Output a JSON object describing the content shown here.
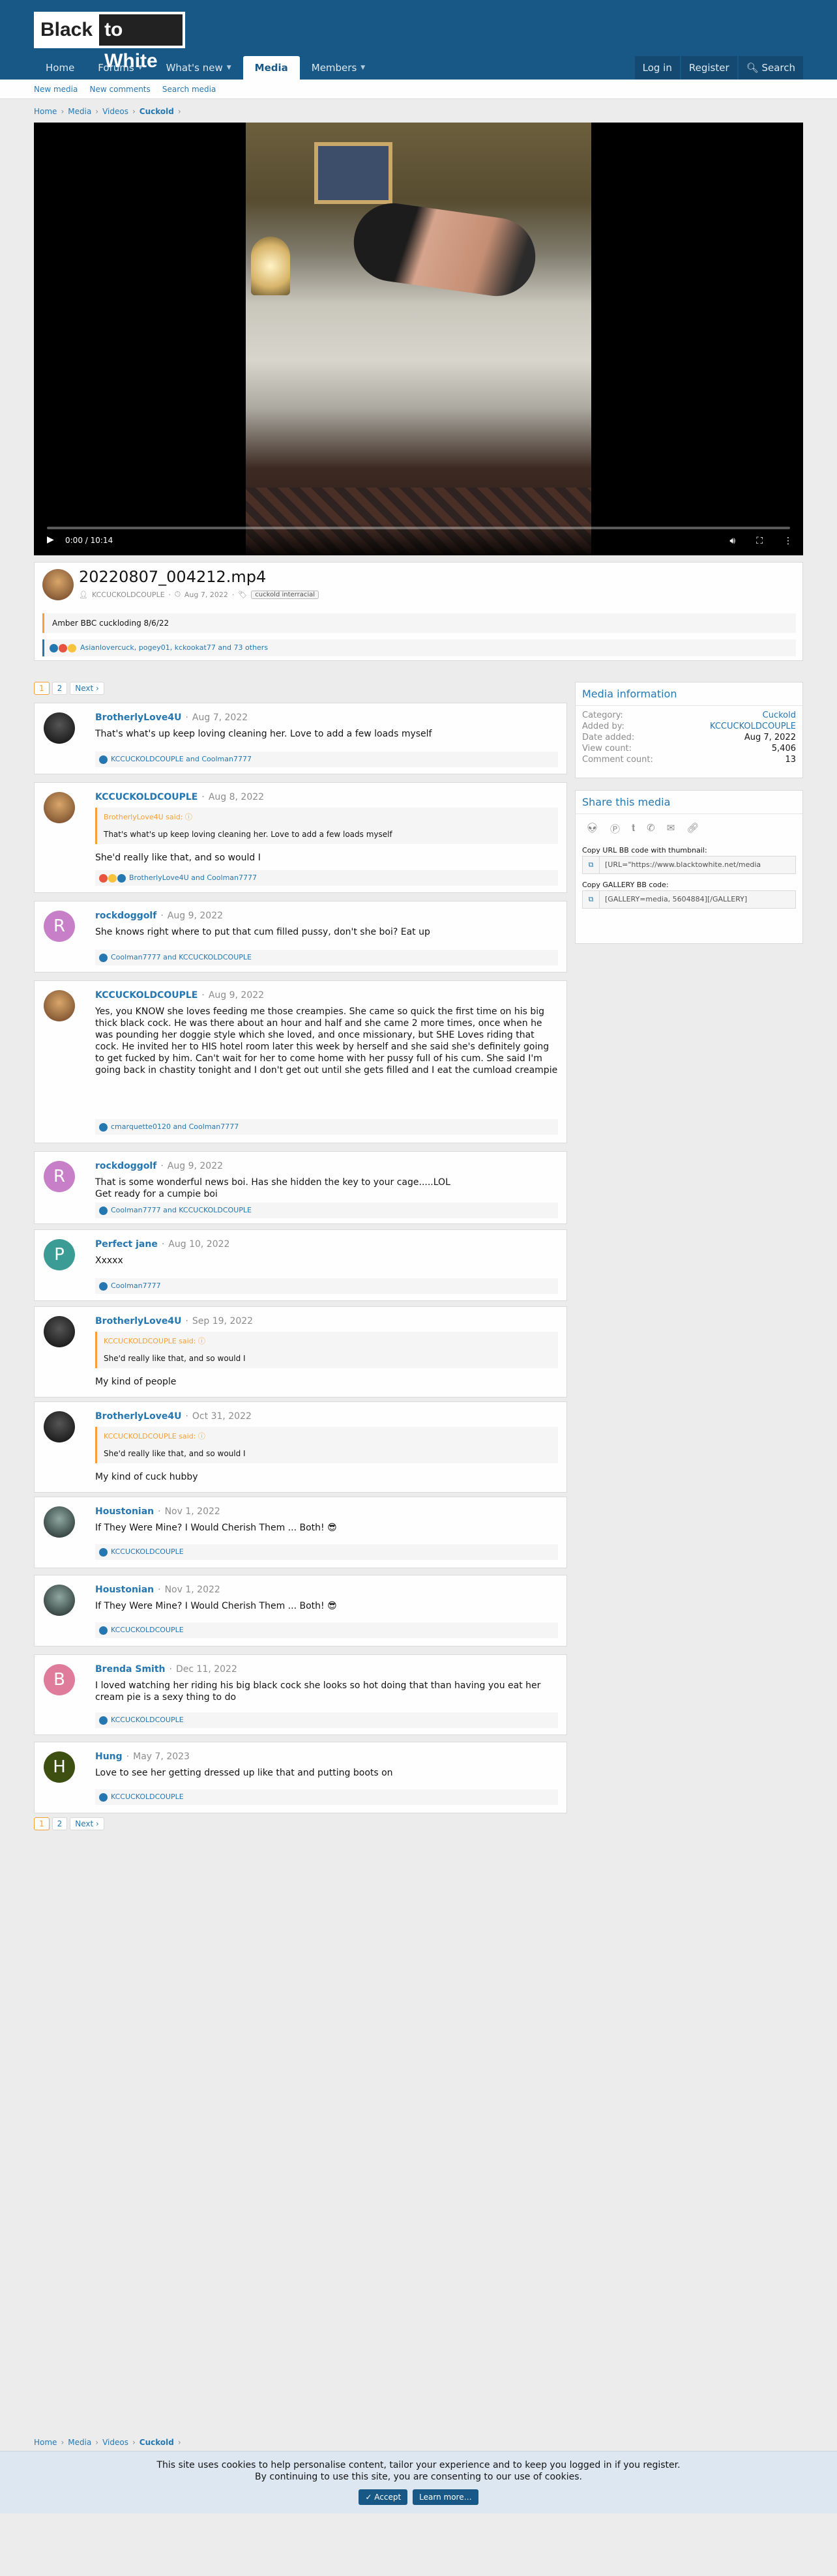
{
  "site": {
    "logo_word1": "Black",
    "logo_word2": "to White"
  },
  "nav": {
    "tabs": [
      {
        "label": "Home"
      },
      {
        "label": "Forums"
      },
      {
        "label": "What's new"
      },
      {
        "label": "Media"
      },
      {
        "label": "Members"
      }
    ],
    "login": "Log in",
    "register": "Register",
    "search": "Search"
  },
  "subnav": {
    "items": [
      "New media",
      "New comments",
      "Search media"
    ]
  },
  "breadcrumb": [
    "Home",
    "Media",
    "Videos",
    "Cuckold"
  ],
  "video": {
    "time": "0:00 / 10:14",
    "progress_fraction": 0
  },
  "media": {
    "title": "20220807_004212.mp4",
    "author": "KCCUCKOLDCOUPLE",
    "date": "Aug 7, 2022",
    "tag": "cuckold interracial",
    "description": "Amber BBC cuckloding 8/6/22",
    "reactions": "Asianlovercuck, pogey01, kckookat77 and 73 others"
  },
  "pagination": {
    "pages": [
      "1",
      "2"
    ],
    "next": "Next ›"
  },
  "comments": [
    {
      "user": "BrotherlyLove4U",
      "date": "Aug 7, 2022",
      "text": "That's what's up keep loving cleaning her. Love to add a few loads myself",
      "reactions": "KCCUCKOLDCOUPLE and Coolman7777"
    },
    {
      "user": "KCCUCKOLDCOUPLE",
      "date": "Aug 8, 2022",
      "quote_head": "BrotherlyLove4U said: ⓘ",
      "quote": "That's what's up keep loving cleaning her. Love to add a few loads myself",
      "text": "She'd really like that, and so would I",
      "reactions": "BrotherlyLove4U and Coolman7777"
    },
    {
      "user": "rockdoggolf",
      "date": "Aug 9, 2022",
      "avatar_letter": "R",
      "text": "She knows right where to put that cum filled pussy, don't she boi? Eat up",
      "reactions": "Coolman7777 and KCCUCKOLDCOUPLE"
    },
    {
      "user": "KCCUCKOLDCOUPLE",
      "date": "Aug 9, 2022",
      "text": "Yes, you KNOW she loves feeding me those creampies. She came so quick the first time on his big thick black cock. He was there about an hour and half and she came 2 more times, once when he was pounding her doggie style which she loved, and once missionary, but SHE Loves riding that cock. He invited her to HIS hotel room later this week by herself and she said she's definitely going to get fucked by him. Can't wait for her to come home with her pussy full of his cum. She said I'm going back in chastity tonight and I don't get out until she gets filled and I eat the cumload creampie",
      "reactions": "cmarquette0120 and Coolman7777"
    },
    {
      "user": "rockdoggolf",
      "date": "Aug 9, 2022",
      "avatar_letter": "R",
      "text": "That is some wonderful news boi. Has she hidden the key to your cage.....LOL",
      "text2": "Get ready for a cumpie boi",
      "reactions": "Coolman7777 and KCCUCKOLDCOUPLE"
    },
    {
      "user": "Perfect jane",
      "date": "Aug 10, 2022",
      "avatar_letter": "P",
      "text": "Xxxxx",
      "reactions": "Coolman7777"
    },
    {
      "user": "BrotherlyLove4U",
      "date": "Sep 19, 2022",
      "quote_head": "KCCUCKOLDCOUPLE said: ⓘ",
      "quote": "She'd really like that, and so would I",
      "text": "My kind of people"
    },
    {
      "user": "BrotherlyLove4U",
      "date": "Oct 31, 2022",
      "quote_head": "KCCUCKOLDCOUPLE said: ⓘ",
      "quote": "She'd really like that, and so would I",
      "text": "My kind of cuck hubby"
    },
    {
      "user": "Houstonian",
      "date": "Nov 1, 2022",
      "text": "If They Were Mine? I Would Cherish Them ... Both! 😎",
      "reactions": "KCCUCKOLDCOUPLE"
    },
    {
      "user": "Houstonian",
      "date": "Nov 1, 2022",
      "text": "If They Were Mine? I Would Cherish Them ... Both! 😎",
      "reactions": "KCCUCKOLDCOUPLE"
    },
    {
      "user": "Brenda Smith",
      "date": "Dec 11, 2022",
      "avatar_letter": "B",
      "text": "I loved watching her riding his big black cock she looks so hot doing that than having you eat her cream pie is a sexy thing to do",
      "reactions": "KCCUCKOLDCOUPLE"
    },
    {
      "user": "Hung",
      "date": "May 7, 2023",
      "avatar_letter": "H",
      "text": "Love to see her getting dressed up like that and putting boots on",
      "reactions": "KCCUCKOLDCOUPLE"
    }
  ],
  "media_info": {
    "heading": "Media information",
    "rows": [
      {
        "k": "Category:",
        "v": "Cuckold"
      },
      {
        "k": "Added by:",
        "v": "KCCUCKOLDCOUPLE"
      },
      {
        "k": "Date added:",
        "v": "Aug 7, 2022"
      },
      {
        "k": "View count:",
        "v": "5,406"
      },
      {
        "k": "Comment count:",
        "v": "13"
      }
    ]
  },
  "share": {
    "heading": "Share this media",
    "icons": [
      "reddit-icon",
      "pinterest-icon",
      "tumblr-icon",
      "whatsapp-icon",
      "email-icon",
      "link-icon"
    ],
    "url_label": "Copy URL BB code with thumbnail:",
    "url_value": "[URL=\"https://www.blacktowhite.net/media",
    "gallery_label": "Copy GALLERY BB code:",
    "gallery_value": "[GALLERY=media, 5604884][/GALLERY]"
  },
  "cookie": {
    "line1": "This site uses cookies to help personalise content, tailor your experience and to keep you logged in if you register.",
    "line2": "By continuing to use this site, you are consenting to our use of cookies.",
    "accept": "✓ Accept",
    "learn": "Learn more…"
  },
  "colors": {
    "header": "#185886",
    "link": "#2577b1",
    "accent": "#f59f35"
  }
}
